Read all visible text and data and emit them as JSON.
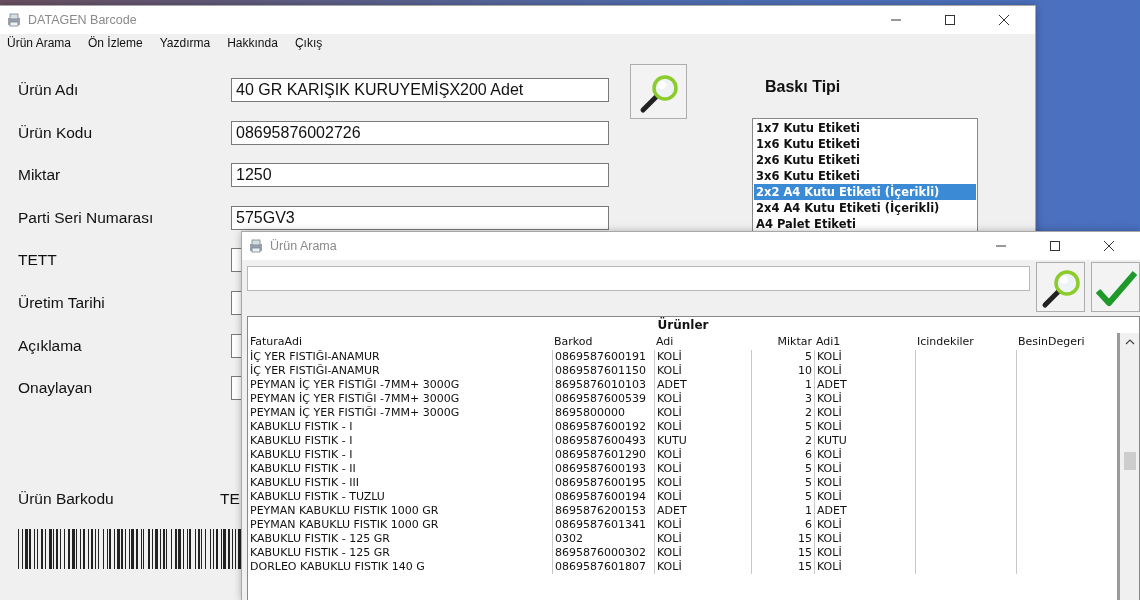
{
  "main_window": {
    "title": "DATAGEN Barcode",
    "menu": [
      "Ürün Arama",
      "Ön İzleme",
      "Yazdırma",
      "Hakkında",
      "Çıkış"
    ],
    "fields": [
      {
        "label": "Ürün Adı",
        "value": "40 GR KARIŞIK KURUYEMİŞX200 Adet"
      },
      {
        "label": "Ürün Kodu",
        "value": "08695876002726"
      },
      {
        "label": "Miktar",
        "value": "1250"
      },
      {
        "label": "Parti Seri Numarası",
        "value": "575GV3"
      },
      {
        "label": "TETT"
      },
      {
        "label": "Üretim Tarihi"
      },
      {
        "label": "Açıklama"
      },
      {
        "label": "Onaylayan"
      }
    ],
    "print_type": {
      "title": "Baskı Tipi",
      "options": [
        {
          "label": "1x7 Kutu Etiketi",
          "selected": false
        },
        {
          "label": "1x6 Kutu Etiketi",
          "selected": false
        },
        {
          "label": "2x6 Kutu Etiketi",
          "selected": false
        },
        {
          "label": "3x6 Kutu Etiketi",
          "selected": false
        },
        {
          "label": "2x2 A4 Kutu Etiketi (İçerikli)",
          "selected": true
        },
        {
          "label": "2x4 A4 Kutu Etiketi (İçerikli)",
          "selected": false
        },
        {
          "label": "A4 Palet Etiketi",
          "selected": false
        }
      ]
    },
    "barcode": {
      "label": "Ürün Barkodu",
      "text": "TE"
    }
  },
  "search_dialog": {
    "title": "Ürün Arama",
    "table": {
      "title": "Ürünler",
      "columns": [
        "FaturaAdi",
        "Barkod",
        "Adi",
        "Miktar",
        "Adi1",
        "Icindekiler",
        "BesinDegeri"
      ],
      "rows": [
        [
          "İÇ YER FISTIĞI-ANAMUR",
          "0869587600191",
          "KOLİ",
          "5",
          "KOLİ"
        ],
        [
          "İÇ YER FISTIĞI-ANAMUR",
          "0869587601150",
          "KOLİ",
          "10",
          "KOLİ"
        ],
        [
          "PEYMAN İÇ YER FISTIĞI -7MM+ 3000G",
          "8695876010103",
          "ADET",
          "1",
          "ADET"
        ],
        [
          "PEYMAN İÇ YER FISTIĞI -7MM+ 3000G",
          "0869587600539",
          "KOLİ",
          "3",
          "KOLİ"
        ],
        [
          "PEYMAN İÇ YER FISTIĞI -7MM+ 3000G",
          "8695800000",
          "KOLİ",
          "2",
          "KOLİ"
        ],
        [
          "KABUKLU FISTIK - I",
          "0869587600192",
          "KOLİ",
          "5",
          "KOLİ"
        ],
        [
          "KABUKLU FISTIK - I",
          "0869587600493",
          "KUTU",
          "2",
          "KUTU"
        ],
        [
          "KABUKLU FISTIK - I",
          "0869587601290",
          "KOLİ",
          "6",
          "KOLİ"
        ],
        [
          "KABUKLU FISTIK - II",
          "0869587600193",
          "KOLİ",
          "5",
          "KOLİ"
        ],
        [
          "KABUKLU FISTIK - III",
          "0869587600195",
          "KOLİ",
          "5",
          "KOLİ"
        ],
        [
          "KABUKLU FISTIK - TUZLU",
          "0869587600194",
          "KOLİ",
          "5",
          "KOLİ"
        ],
        [
          "PEYMAN KABUKLU FISTIK 1000 GR",
          "8695876200153",
          "ADET",
          "1",
          "ADET"
        ],
        [
          "PEYMAN KABUKLU FISTIK 1000 GR",
          "0869587601341",
          "KOLİ",
          "6",
          "KOLİ"
        ],
        [
          "KABUKLU FISTIK - 125 GR",
          "0302",
          "KOLİ",
          "15",
          "KOLİ"
        ],
        [
          "KABUKLU FISTIK - 125 GR",
          "8695876000302",
          "KOLİ",
          "15",
          "KOLİ"
        ],
        [
          "DORLEO KABUKLU FISTIK 140 G",
          "0869587601807",
          "KOLİ",
          "15",
          "KOLİ"
        ]
      ]
    }
  }
}
